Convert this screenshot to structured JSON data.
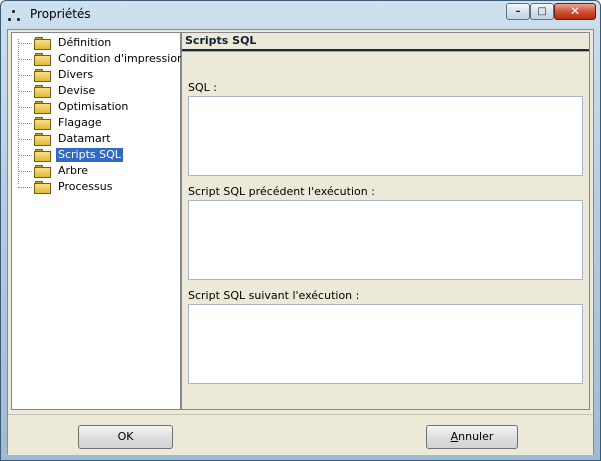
{
  "window": {
    "title": "Propriétés",
    "controls": {
      "minimize": "–",
      "maximize": "□",
      "close": "✕"
    }
  },
  "tree": {
    "items": [
      {
        "label": "Définition",
        "icon": "folder-icon",
        "selected": false
      },
      {
        "label": "Condition d'impression",
        "icon": "folder-icon",
        "selected": false
      },
      {
        "label": "Divers",
        "icon": "folder-icon",
        "selected": false
      },
      {
        "label": "Devise",
        "icon": "folder-icon",
        "selected": false
      },
      {
        "label": "Optimisation",
        "icon": "folder-icon",
        "selected": false
      },
      {
        "label": "Flagage",
        "icon": "folder-icon",
        "selected": false
      },
      {
        "label": "Datamart",
        "icon": "folder-icon",
        "selected": false
      },
      {
        "label": "Scripts SQL",
        "icon": "folder-icon",
        "selected": true
      },
      {
        "label": "Arbre",
        "icon": "folder-icon",
        "selected": false
      },
      {
        "label": "Processus",
        "icon": "folder-icon",
        "selected": false
      }
    ]
  },
  "panel": {
    "title": "Scripts SQL",
    "sql_label": "SQL :",
    "sql_value": "",
    "pre_label": "Script SQL précédent l'exécution :",
    "pre_value": "",
    "post_label": "Script SQL suivant l'exécution :",
    "post_value": ""
  },
  "buttons": {
    "ok": "OK",
    "cancel_underlined": "A",
    "cancel_rest": "nnuler"
  },
  "colors": {
    "selection": "#3169c6",
    "dialog_bg": "#ece9d8"
  }
}
